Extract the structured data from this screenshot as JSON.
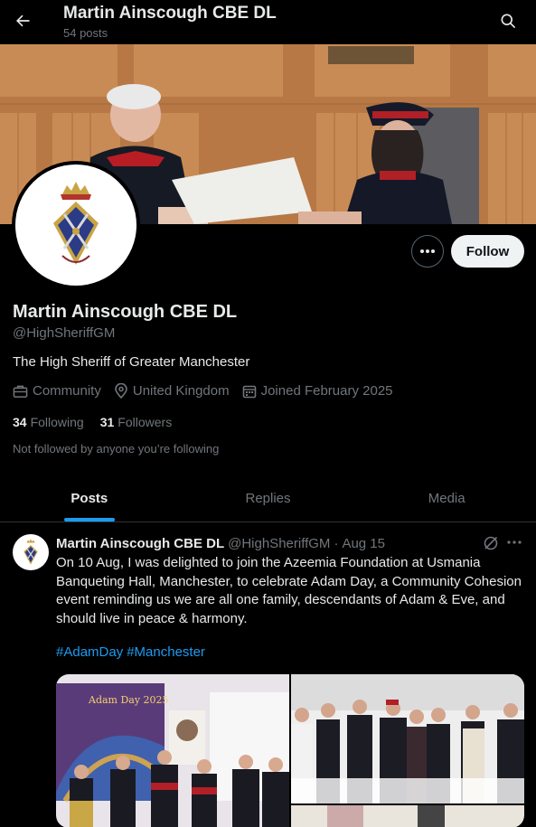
{
  "topbar": {
    "title": "Martin Ainscough CBE DL",
    "post_count": "54 posts",
    "icons": {
      "back": "arrow-left-icon",
      "search": "search-icon"
    }
  },
  "banner": {
    "description_icon": "banner-photo"
  },
  "profile": {
    "display_name": "Martin Ainscough CBE DL",
    "handle": "@HighSheriffGM",
    "bio": "The High Sheriff of Greater Manchester",
    "category": "Community",
    "location": "United Kingdom",
    "joined": "Joined February 2025",
    "following_count": "34",
    "following_label": "Following",
    "followers_count": "31",
    "followers_label": "Followers",
    "not_followed": "Not followed by anyone you’re following",
    "follow_button": "Follow"
  },
  "tabs": [
    {
      "label": "Posts",
      "active": true
    },
    {
      "label": "Replies",
      "active": false
    },
    {
      "label": "Media",
      "active": false
    }
  ],
  "post": {
    "name": "Martin Ainscough CBE DL",
    "handle": "@HighSheriffGM",
    "separator": "·",
    "date": "Aug 15",
    "text": "On 10 Aug, I was delighted to join the Azeemia Foundation at Usmania Banqueting Hall, Manchester, to celebrate Adam Day, a Community Cohesion event reminding us we are all one family, descendants of Adam & Eve, and should live in peace & harmony.",
    "hashtags": [
      "#AdamDay",
      "#Manchester"
    ],
    "media_banner_text": "Adam Day 2025"
  },
  "colors": {
    "background": "#000000",
    "text_primary": "#e7e9ea",
    "text_secondary": "#71767b",
    "accent": "#1d9bf0",
    "follow_bg": "#eff3f4"
  }
}
